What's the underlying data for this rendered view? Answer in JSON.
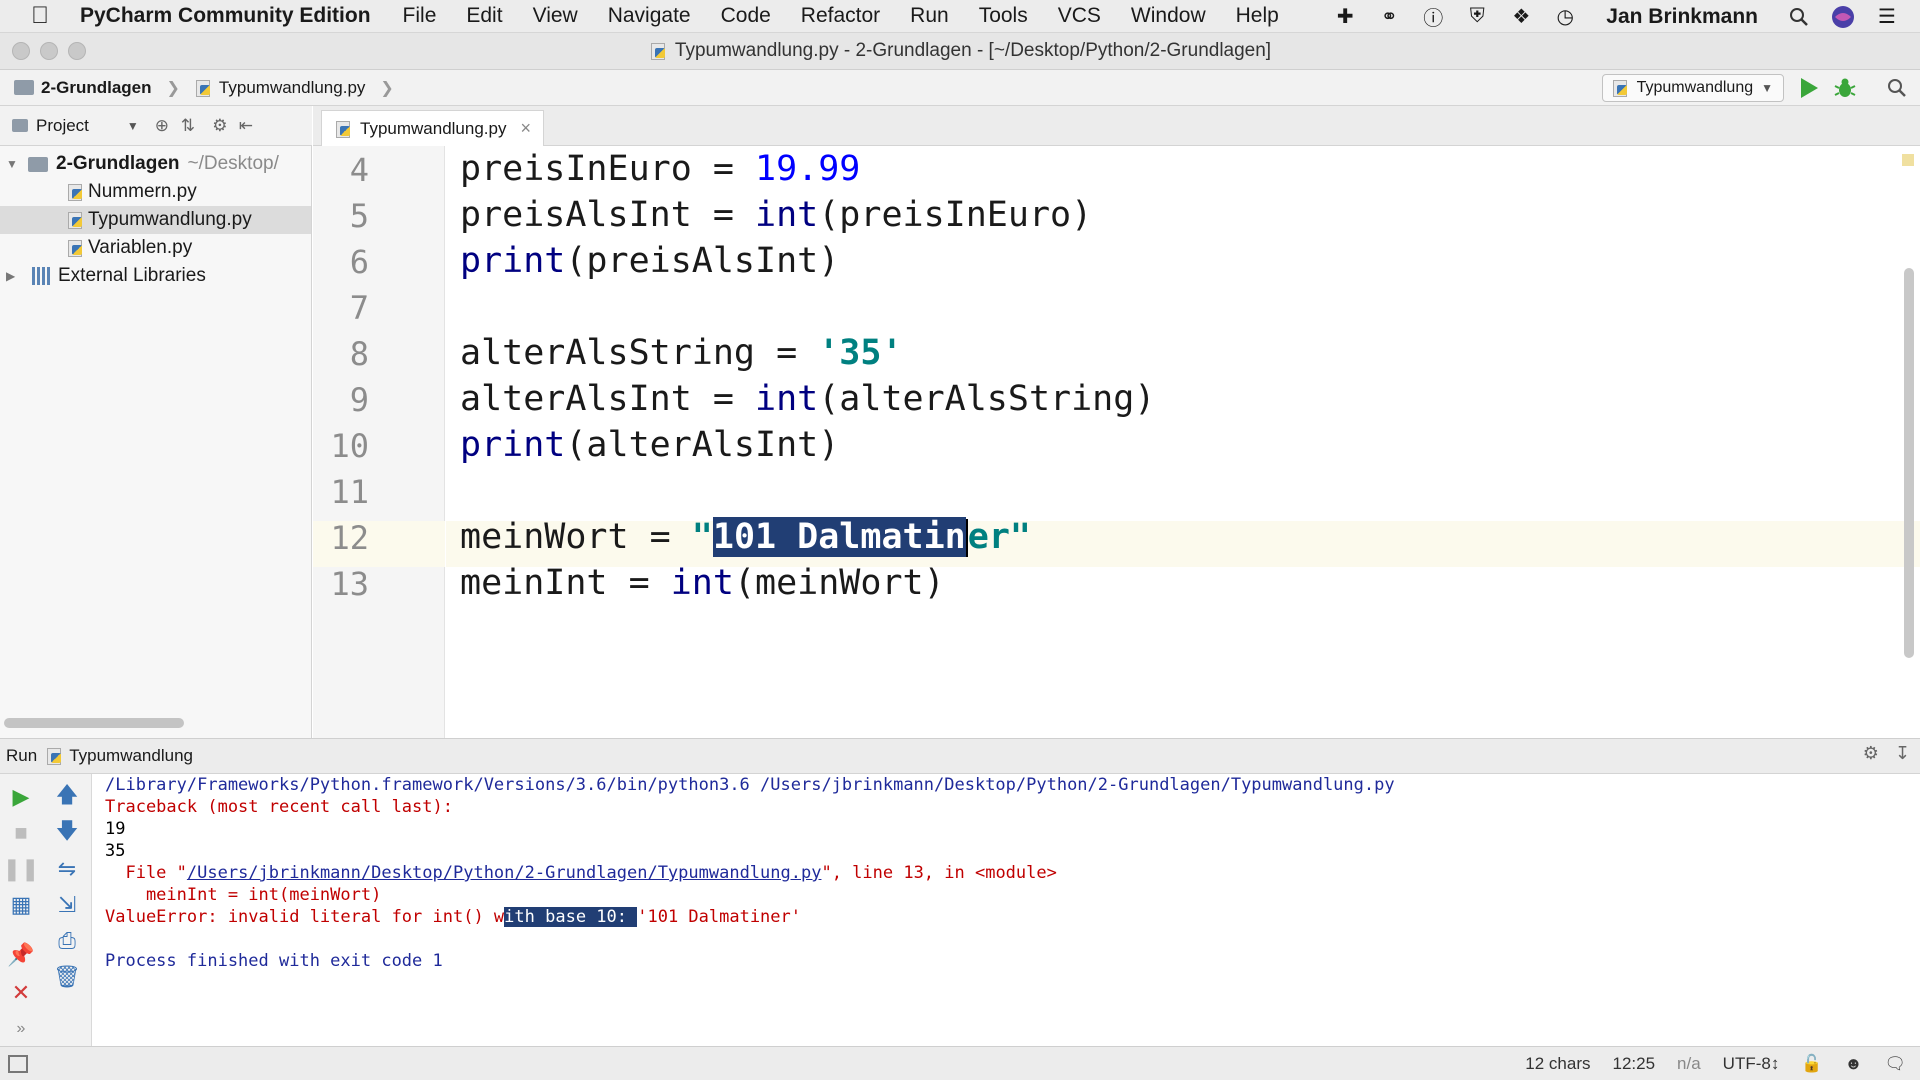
{
  "menubar": {
    "apple_icon": "apple-logo-icon",
    "app_name": "PyCharm Community Edition",
    "menus": [
      "File",
      "Edit",
      "View",
      "Navigate",
      "Code",
      "Refactor",
      "Run",
      "Tools",
      "VCS",
      "Window",
      "Help"
    ],
    "tray_icons": [
      "plus-icon",
      "creative-cloud-icon",
      "info-icon",
      "shield-icon",
      "feather-icon",
      "time-machine-icon"
    ],
    "user_name": "Jan Brinkmann"
  },
  "window": {
    "title": "Typumwandlung.py - 2-Grundlagen - [~/Desktop/Python/2-Grundlagen]"
  },
  "navbar": {
    "breadcrumbs": [
      "2-Grundlagen",
      "Typumwandlung.py"
    ],
    "run_config": "Typumwandlung"
  },
  "project_panel": {
    "label": "Project",
    "tree": [
      {
        "name": "2-Grundlagen",
        "suffix": "~/Desktop/"
      },
      {
        "name": "Nummern.py"
      },
      {
        "name": "Typumwandlung.py"
      },
      {
        "name": "Variablen.py"
      },
      {
        "name": "External Libraries"
      }
    ]
  },
  "editor": {
    "tab_label": "Typumwandlung.py",
    "tab_close": "×",
    "line_numbers": [
      "4",
      "5",
      "6",
      "7",
      "8",
      "9",
      "10",
      "11",
      "12",
      "13"
    ],
    "lines": {
      "l4": {
        "a": "preisInEuro = ",
        "b": "19.99"
      },
      "l5": {
        "a": "preisAlsInt = ",
        "b": "int",
        "c": "(preisInEuro)"
      },
      "l6": {
        "a": "print",
        "b": "(preisAlsInt)"
      },
      "l8": {
        "a": "alterAlsString = ",
        "b": "'35'"
      },
      "l9": {
        "a": "alterAlsInt = ",
        "b": "int",
        "c": "(alterAlsString)"
      },
      "l10": {
        "a": "print",
        "b": "(alterAlsInt)"
      },
      "l12": {
        "a": "meinWort = ",
        "b": "\"",
        "c": "101 Dalmatin",
        "d": "er\""
      },
      "l13": {
        "a": "meinInt = ",
        "b": "int",
        "c": "(meinWort)"
      }
    }
  },
  "run_panel": {
    "label": "Run",
    "config": "Typumwandlung",
    "console": {
      "c1": "/Library/Frameworks/Python.framework/Versions/3.6/bin/python3.6 /Users/jbrinkmann/Desktop/Python/2-Grundlagen/Typumwandlung.py",
      "c2": "Traceback (most recent call last):",
      "c3": "19",
      "c4": "35",
      "c5a": "  File \"",
      "c5b": "/Users/jbrinkmann/Desktop/Python/2-Grundlagen/Typumwandlung.py",
      "c5c": "\", line 13, in <module>",
      "c6": "    meinInt = int(meinWort)",
      "c7a": "ValueError: invalid literal for int() w",
      "c7b": "ith base 10: ",
      "c7c": "'101 Dalmatiner'",
      "c9": "Process finished with exit code 1"
    }
  },
  "statusbar": {
    "chars": "12 chars",
    "position": "12:25",
    "line_sep": "n/a",
    "encoding": "UTF-8↕"
  },
  "colors": {
    "keyword": "#000080",
    "number": "#0000ff",
    "string": "#008080",
    "selection": "#213e74",
    "error": "#c00000"
  }
}
